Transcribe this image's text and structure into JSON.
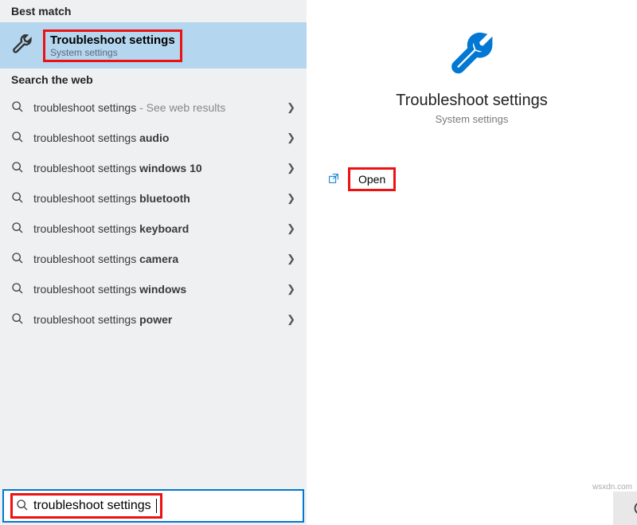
{
  "headers": {
    "best_match": "Best match",
    "search_web": "Search the web"
  },
  "best_match": {
    "title": "Troubleshoot settings",
    "subtitle": "System settings"
  },
  "web_results": [
    {
      "prefix": "troubleshoot settings",
      "suffix": "",
      "trail": " - See web results"
    },
    {
      "prefix": "troubleshoot settings ",
      "suffix": "audio",
      "trail": ""
    },
    {
      "prefix": "troubleshoot settings ",
      "suffix": "windows 10",
      "trail": ""
    },
    {
      "prefix": "troubleshoot settings ",
      "suffix": "bluetooth",
      "trail": ""
    },
    {
      "prefix": "troubleshoot settings ",
      "suffix": "keyboard",
      "trail": ""
    },
    {
      "prefix": "troubleshoot settings ",
      "suffix": "camera",
      "trail": ""
    },
    {
      "prefix": "troubleshoot settings ",
      "suffix": "windows",
      "trail": ""
    },
    {
      "prefix": "troubleshoot settings ",
      "suffix": "power",
      "trail": ""
    }
  ],
  "search": {
    "value": "troubleshoot settings"
  },
  "preview": {
    "title": "Troubleshoot settings",
    "subtitle": "System settings",
    "open_label": "Open"
  },
  "watermark": "wsxdn.com"
}
